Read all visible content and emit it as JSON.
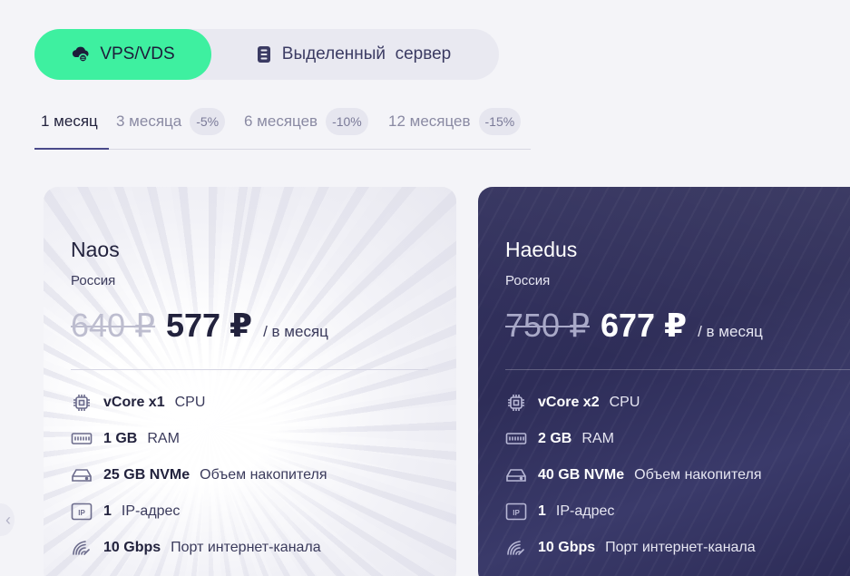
{
  "product_toggle": {
    "vps_label": "VPS/VDS",
    "dedicated_label": "Выделенный  сервер"
  },
  "period_tabs": [
    {
      "label": "1 месяц",
      "discount": ""
    },
    {
      "label": "3 месяца",
      "discount": "-5%"
    },
    {
      "label": "6 месяцев",
      "discount": "-10%"
    },
    {
      "label": "12 месяцев",
      "discount": "-15%"
    }
  ],
  "plans": [
    {
      "name": "Naos",
      "location": "Россия",
      "old_price": "640 ₽",
      "price": "577 ₽",
      "period": "/ в месяц",
      "specs": [
        {
          "icon": "cpu-icon",
          "value": "vCore x1",
          "label": "CPU"
        },
        {
          "icon": "ram-icon",
          "value": "1 GB",
          "label": "RAM"
        },
        {
          "icon": "storage-icon",
          "value": "25 GB NVMe",
          "label": "Объем накопителя"
        },
        {
          "icon": "ip-icon",
          "value": "1",
          "label": "IP-адрес"
        },
        {
          "icon": "network-icon",
          "value": "10 Gbps",
          "label": "Порт интернет-канала"
        }
      ]
    },
    {
      "name": "Haedus",
      "location": "Россия",
      "old_price": "750 ₽",
      "price": "677 ₽",
      "period": "/ в месяц",
      "specs": [
        {
          "icon": "cpu-icon",
          "value": "vCore x2",
          "label": "CPU"
        },
        {
          "icon": "ram-icon",
          "value": "2 GB",
          "label": "RAM"
        },
        {
          "icon": "storage-icon",
          "value": "40 GB NVMe",
          "label": "Объем накопителя"
        },
        {
          "icon": "ip-icon",
          "value": "1",
          "label": "IP-адрес"
        },
        {
          "icon": "network-icon",
          "value": "10 Gbps",
          "label": "Порт интернет-канала"
        }
      ]
    }
  ],
  "colors": {
    "accent": "#3ef0a0",
    "dark_card": "#2e2d58",
    "background": "#f4f4f8"
  }
}
